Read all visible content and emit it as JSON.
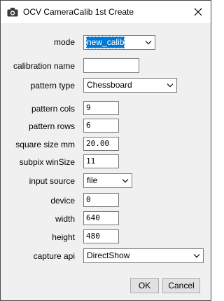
{
  "window": {
    "title": "OCV CameraCalib 1st Create"
  },
  "form": {
    "mode": {
      "label": "mode",
      "value": "new_calib"
    },
    "calibration_name": {
      "label": "calibration name",
      "value": ""
    },
    "pattern_type": {
      "label": "pattern type",
      "value": "Chessboard"
    },
    "pattern_cols": {
      "label": "pattern cols",
      "value": "9"
    },
    "pattern_rows": {
      "label": "pattern rows",
      "value": "6"
    },
    "square_size_mm": {
      "label": "square size mm",
      "value": "20.00"
    },
    "subpix_winsize": {
      "label": "subpix winSize",
      "value": "11"
    },
    "input_source": {
      "label": "input source",
      "value": "file"
    },
    "device": {
      "label": "device",
      "value": "0"
    },
    "width": {
      "label": "width",
      "value": "640"
    },
    "height": {
      "label": "height",
      "value": "480"
    },
    "capture_api": {
      "label": "capture api",
      "value": "DirectShow"
    }
  },
  "buttons": {
    "ok": "OK",
    "cancel": "Cancel"
  },
  "icons": {
    "app": "camera-icon",
    "close": "close-icon",
    "dropdown": "chevron-down-icon"
  },
  "colors": {
    "selection": "#0078d7",
    "dialog_bg": "#f0f0f0",
    "titlebar_bg": "#ffffff"
  }
}
